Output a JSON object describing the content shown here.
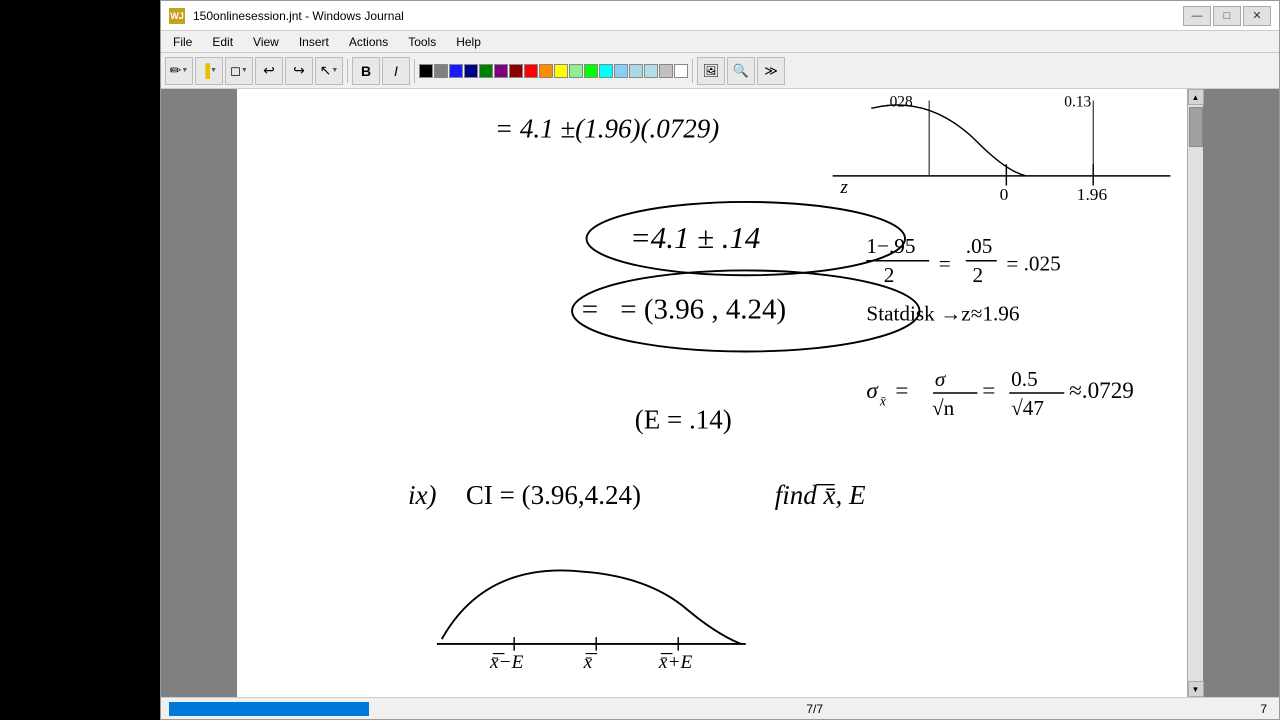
{
  "window": {
    "title": "150onlinesession.jnt - Windows Journal",
    "icon_label": "WJ"
  },
  "titlebar": {
    "minimize": "—",
    "maximize": "□",
    "close": "✕"
  },
  "menu": {
    "items": [
      "File",
      "Edit",
      "View",
      "Insert",
      "Actions",
      "Tools",
      "Help"
    ]
  },
  "toolbar": {
    "pen_tool": "✏",
    "highlighter": "▐",
    "eraser": "◻",
    "undo": "↩",
    "redo": "↪",
    "more": "▶"
  },
  "colors": {
    "swatches": [
      "#000000",
      "#808080",
      "#0000ff",
      "#0000aa",
      "#008000",
      "#800080",
      "#800000",
      "#ff0000",
      "#ff8000",
      "#ffff00",
      "#80ff00",
      "#00ff00",
      "#00ffff",
      "#0080ff",
      "#c0c0c0",
      "#ffffff"
    ]
  },
  "statusbar": {
    "page_info": "7/7",
    "page_number": "7"
  }
}
